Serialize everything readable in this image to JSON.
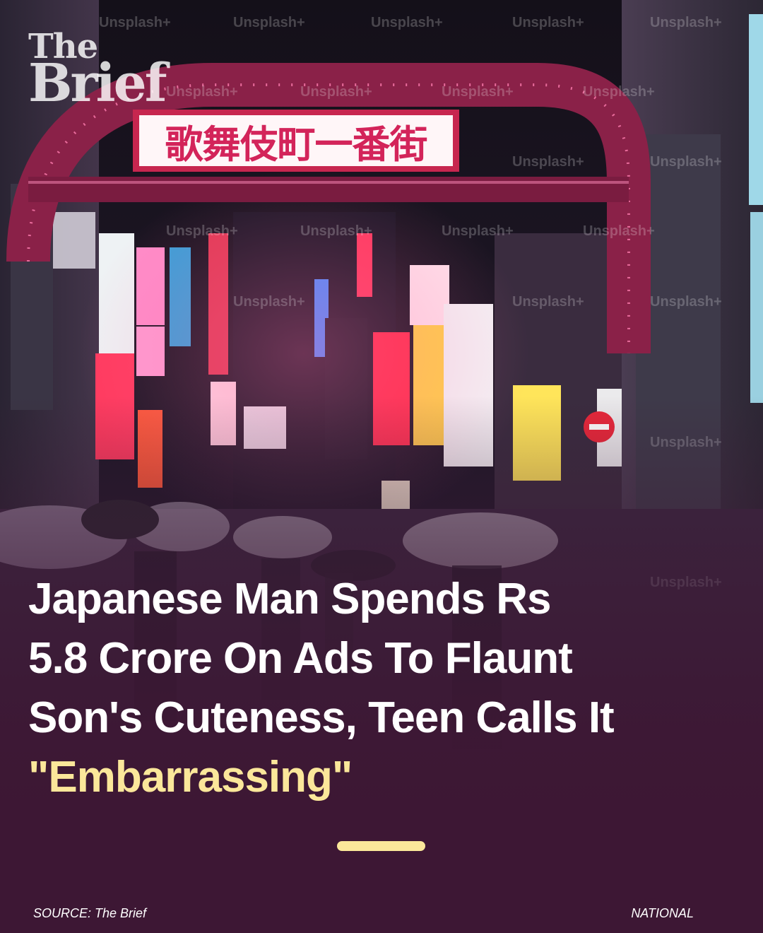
{
  "logo": {
    "line1": "The",
    "line2": "Brief"
  },
  "sign_text": "歌舞伎町一番街",
  "watermark": "Unsplash+",
  "headline": {
    "line1": "Japanese Man Spends Rs",
    "line2": "5.8 Crore On Ads To Flaunt",
    "line3": "Son's Cuteness, Teen Calls It",
    "highlight": "\"Embarrassing\""
  },
  "footer": {
    "source": "SOURCE: The Brief",
    "category": "NATIONAL"
  },
  "colors": {
    "highlight": "#fbe79a",
    "background": "#3d1734",
    "text": "#ffffff"
  }
}
